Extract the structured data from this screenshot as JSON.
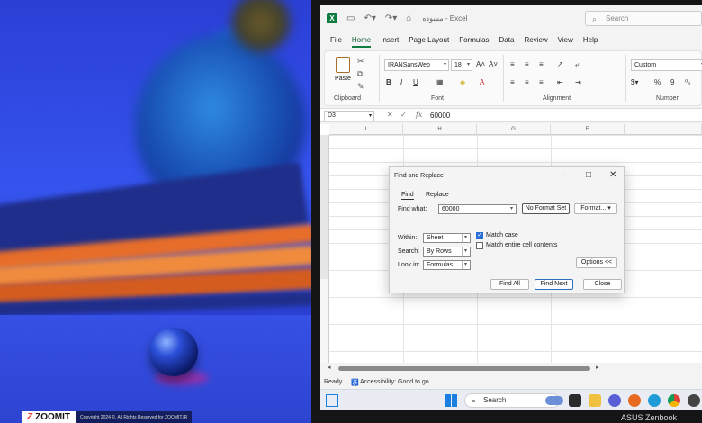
{
  "photo": {
    "logo_text": "ZOOMIT",
    "copyright": "Copyright 2024 ©, All Rights Reserved for ZOOMIT.IR"
  },
  "laptop": {
    "brand": "ASUS Zenbook"
  },
  "excel": {
    "app_name": "Excel",
    "doc_title": "مسوده - Excel",
    "search_placeholder": "Search",
    "tabs": [
      "File",
      "Home",
      "Insert",
      "Page Layout",
      "Formulas",
      "Data",
      "Review",
      "View",
      "Help"
    ],
    "active_tab": "Home",
    "ribbon": {
      "clipboard_label": "Clipboard",
      "paste_label": "Paste",
      "font_name": "IRANSansWeb",
      "font_size": "18",
      "font_label": "Font",
      "alignment_label": "Alignment",
      "number_format": "Custom",
      "number_label": "Number"
    },
    "name_box": "D3",
    "formula_value": "60000",
    "columns": [
      "I",
      "H",
      "G",
      "F"
    ],
    "status_ready": "Ready",
    "status_accessibility": "Accessibility: Good to go"
  },
  "taskbar": {
    "search_label": "Search"
  },
  "dialog": {
    "title": "Find and Replace",
    "tab_find": "Find",
    "tab_replace": "Replace",
    "find_what_label": "Find what:",
    "find_what_value": "60000",
    "no_format_set": "No Format Set",
    "format_button": "Format...",
    "within_label": "Within:",
    "within_value": "Sheet",
    "search_label": "Search:",
    "search_value": "By Rows",
    "look_in_label": "Look in:",
    "look_in_value": "Formulas",
    "match_case": "Match case",
    "match_case_checked": true,
    "match_entire": "Match entire cell contents",
    "match_entire_checked": false,
    "options_button": "Options <<",
    "find_all": "Find All",
    "find_next": "Find Next",
    "close": "Close"
  },
  "colors": {
    "excel_green": "#107c41",
    "photo_blue": "#3554ee",
    "accent_blue": "#2b6fd6"
  }
}
